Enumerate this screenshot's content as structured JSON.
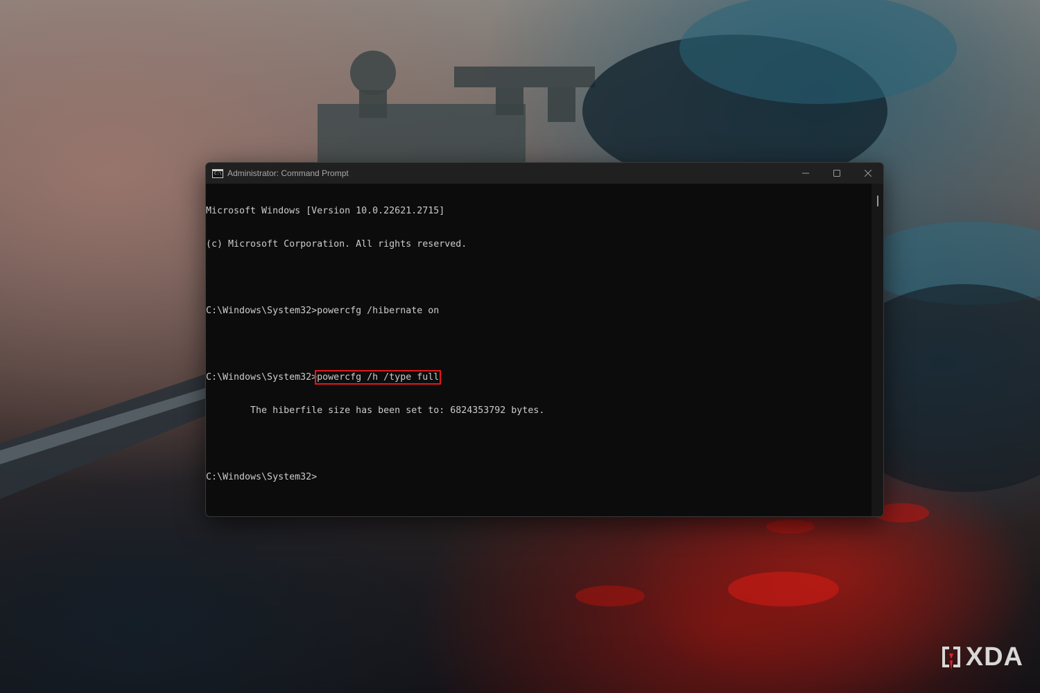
{
  "window": {
    "title": "Administrator: Command Prompt",
    "icon": "cmd-icon",
    "controls": [
      "minimize-icon",
      "maximize-icon",
      "close-icon"
    ]
  },
  "console": {
    "lines": [
      "Microsoft Windows [Version 10.0.22621.2715]",
      "(c) Microsoft Corporation. All rights reserved.",
      "",
      "C:\\Windows\\System32>powercfg /hibernate on",
      "",
      "C:\\Windows\\System32>",
      "        The hiberfile size has been set to: 6824353792 bytes.",
      "",
      "C:\\Windows\\System32>"
    ],
    "highlighted_command": "powercfg /h /type full",
    "highlight_color": "#e81818"
  },
  "watermark": {
    "text": "XDA",
    "logo_color": "#e0232e"
  }
}
